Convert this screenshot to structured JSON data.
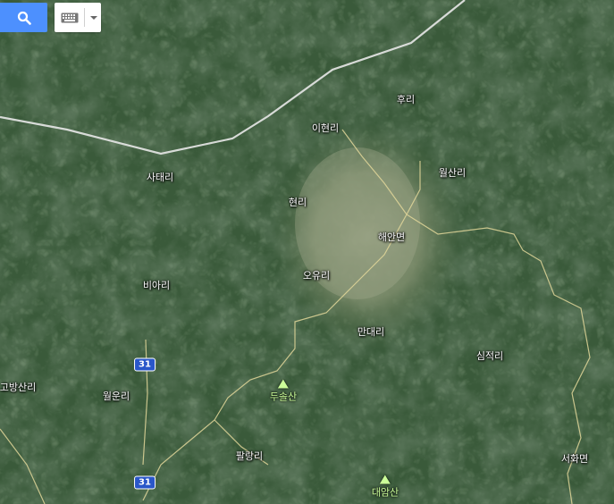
{
  "toolbar": {
    "search_icon": "search-icon",
    "keyboard_icon": "keyboard-icon",
    "dropdown_icon": "caret-down-icon",
    "search_color": "#4d90fe"
  },
  "places": [
    {
      "id": "huri",
      "name": "후리"
    },
    {
      "id": "ihyeonri",
      "name": "이현리"
    },
    {
      "id": "wolsanri",
      "name": "월산리"
    },
    {
      "id": "sataeri",
      "name": "사태리"
    },
    {
      "id": "hyeonri",
      "name": "현리"
    },
    {
      "id": "haeanmyeon",
      "name": "해안면"
    },
    {
      "id": "oyuri",
      "name": "오유리"
    },
    {
      "id": "biari",
      "name": "비아리"
    },
    {
      "id": "mandaeri",
      "name": "만대리"
    },
    {
      "id": "simjeokri",
      "name": "심적리"
    },
    {
      "id": "gobangsanri",
      "name": "고방산리"
    },
    {
      "id": "worunri",
      "name": "월운리"
    },
    {
      "id": "palrangri",
      "name": "팔랑리"
    },
    {
      "id": "seohwamyeon",
      "name": "서화면"
    }
  ],
  "peaks": [
    {
      "id": "dusolsan",
      "name": "두솔산"
    },
    {
      "id": "daeamsan",
      "name": "대암산"
    }
  ],
  "route_shields": [
    {
      "id": "route31-upper",
      "label": "31"
    },
    {
      "id": "route31-lower",
      "label": "31"
    }
  ]
}
